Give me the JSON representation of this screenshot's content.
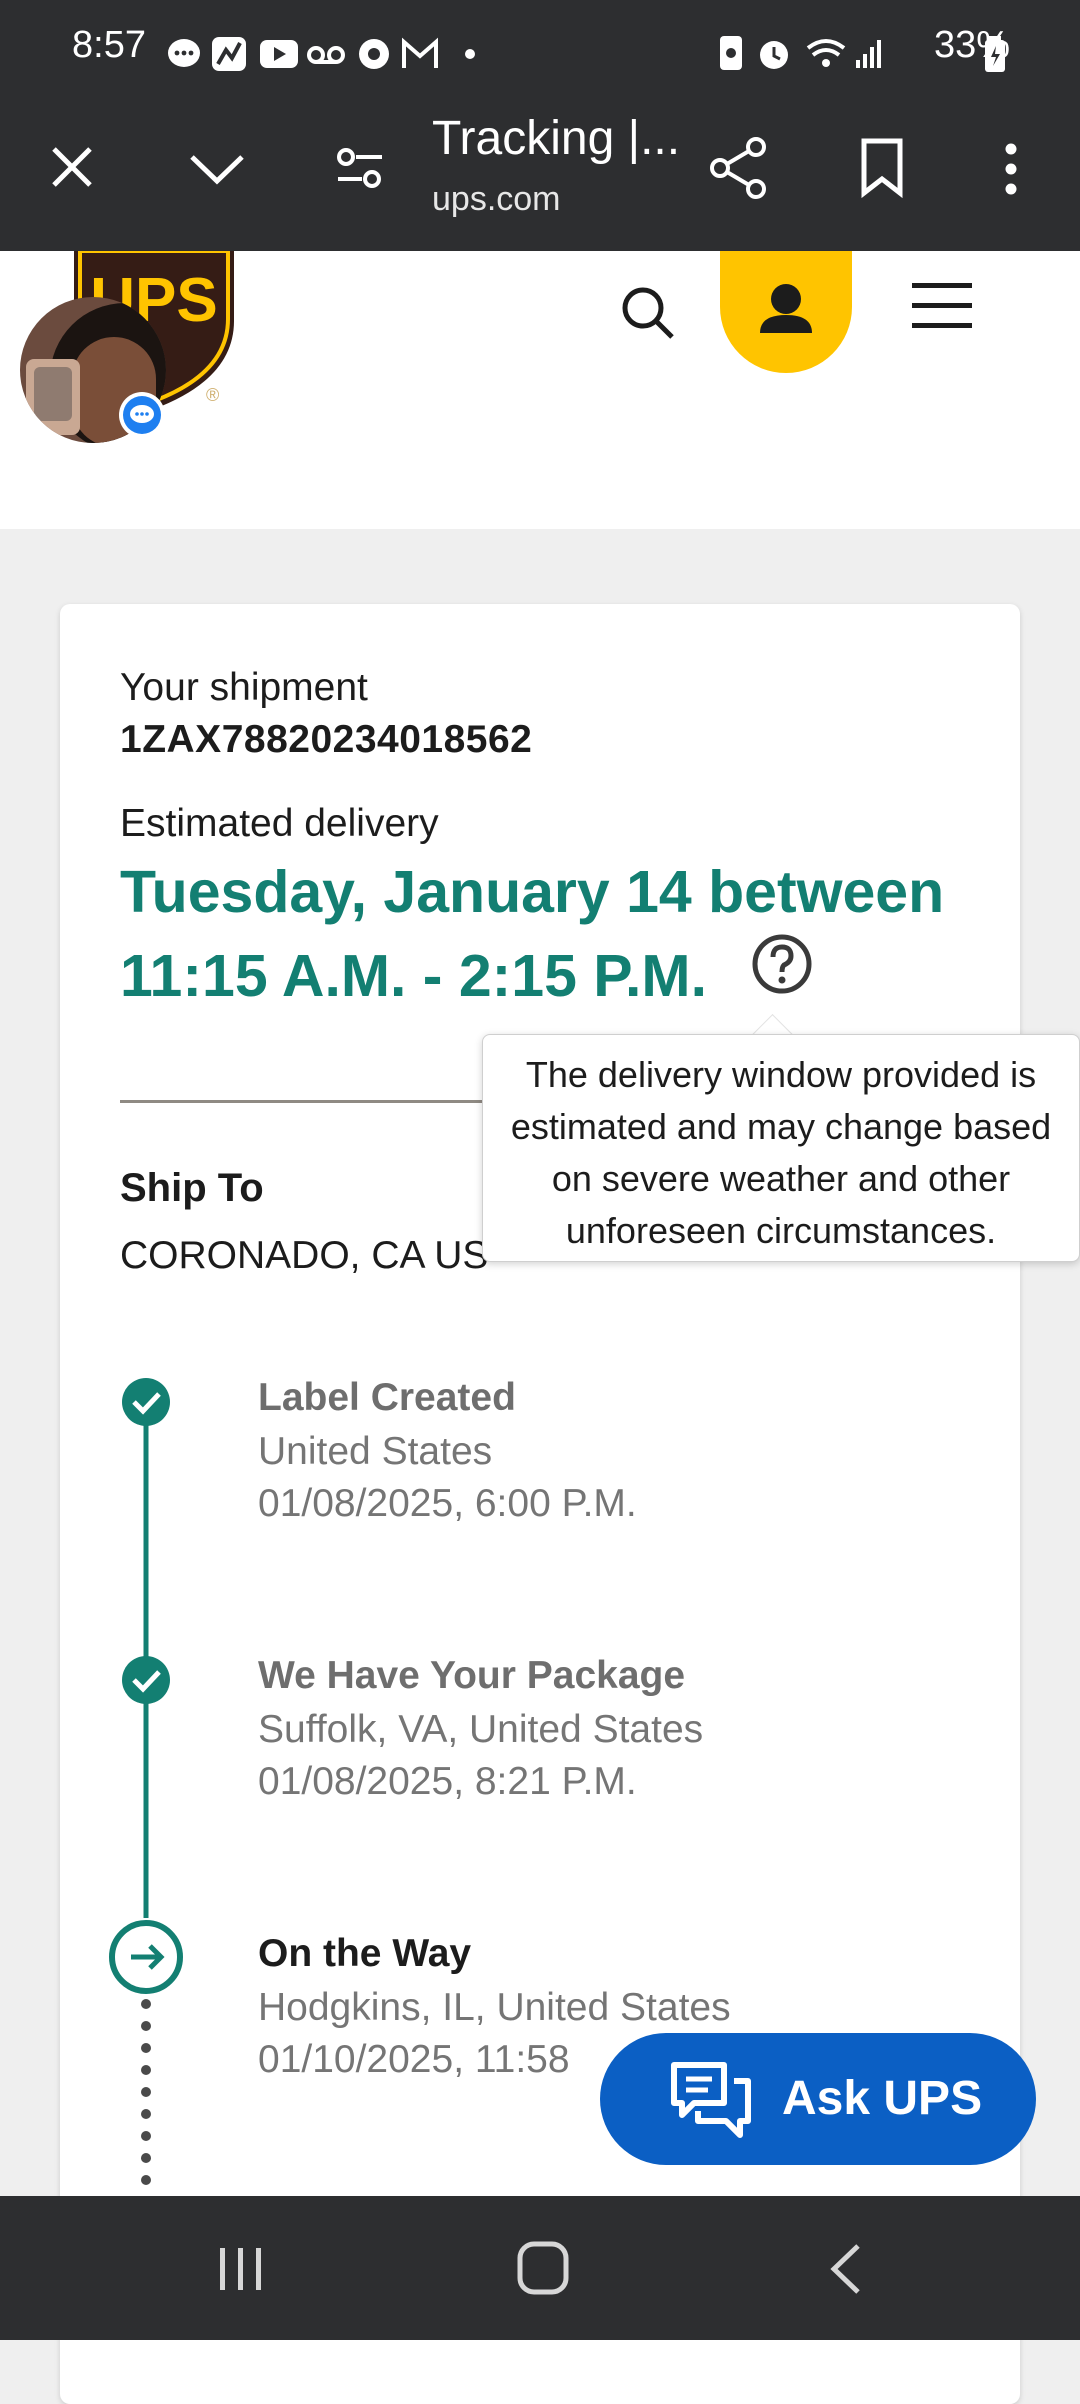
{
  "status_bar": {
    "time": "8:57",
    "battery": "33%",
    "notification_icons": [
      "chat-bubble-icon",
      "app-icon",
      "youtube-icon",
      "voicemail-icon",
      "chrome-icon",
      "gmail-icon",
      "dot-icon"
    ],
    "system_icons": [
      "battery-saver-icon",
      "alarm-icon",
      "wifi-icon",
      "signal-icon",
      "battery-icon"
    ]
  },
  "browser": {
    "title": "Tracking |...",
    "url": "ups.com",
    "icons": [
      "close-icon",
      "chevron-down-icon",
      "page-settings-icon",
      "share-icon",
      "bookmark-icon",
      "more-vert-icon"
    ]
  },
  "site_header": {
    "logo_text": "UPS",
    "icons": [
      "search-icon",
      "account-icon",
      "menu-icon"
    ]
  },
  "shipment": {
    "label": "Your shipment",
    "tracking_number": "1ZAX78820234018562",
    "estimated_label": "Estimated delivery",
    "estimated_line1": "Tuesday, January 14 between",
    "estimated_line2": "11:15 A.M. - 2:15 P.M."
  },
  "tooltip": {
    "text": "The delivery window provided is estimated and may change based on severe weather and other unforeseen circumstances."
  },
  "ship_to": {
    "label": "Ship To",
    "value": "CORONADO, CA US"
  },
  "timeline": [
    {
      "title": "Label Created",
      "location": "United States",
      "datetime": "01/08/2025, 6:00 P.M.",
      "status": "done"
    },
    {
      "title": "We Have Your Package",
      "location": "Suffolk, VA, United States",
      "datetime": "01/08/2025, 8:21 P.M.",
      "status": "done"
    },
    {
      "title": "On the Way",
      "location": "Hodgkins, IL, United States",
      "datetime": "01/10/2025, 11:58",
      "status": "current"
    }
  ],
  "chat": {
    "label": "Ask UPS"
  },
  "colors": {
    "teal": "#137f72",
    "ups_brown": "#351c15",
    "ups_gold": "#ffc400",
    "chat_blue": "#0b5fc4"
  }
}
